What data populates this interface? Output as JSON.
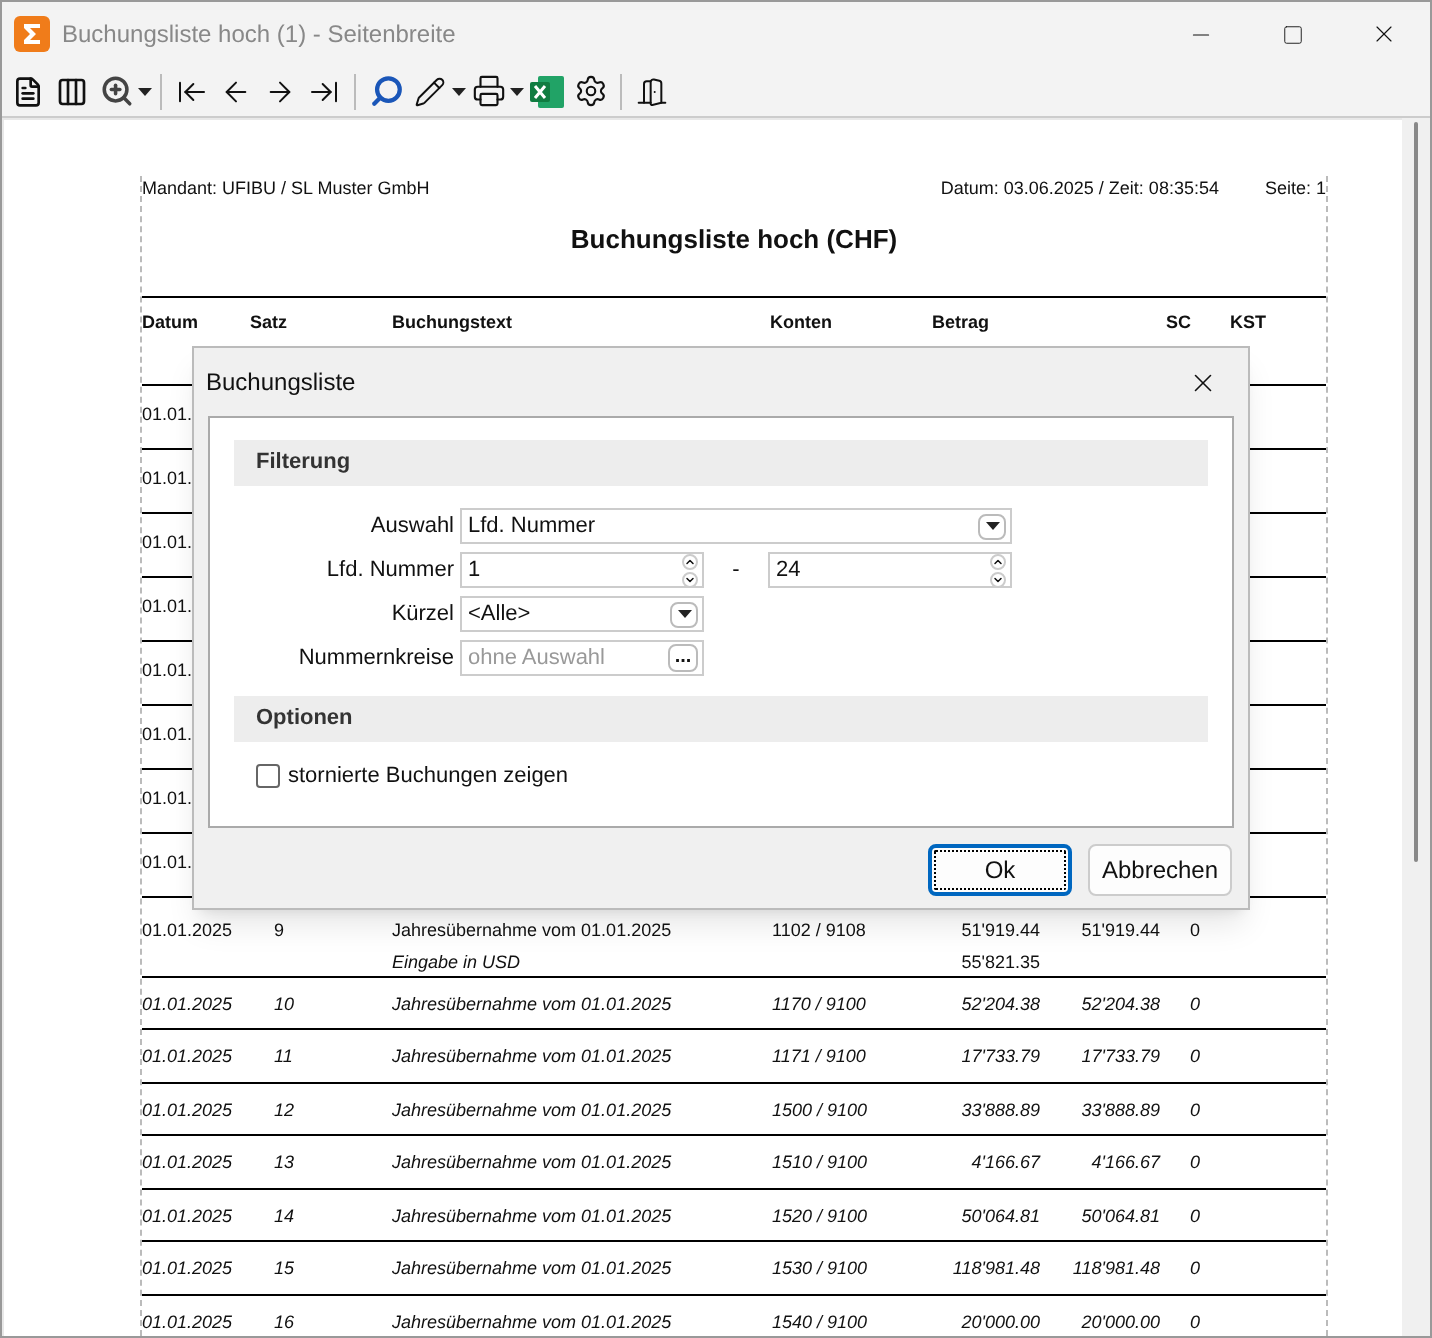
{
  "window": {
    "title": "Buchungsliste hoch (1) - Seitenbreite"
  },
  "report": {
    "mandant": "Mandant: UFIBU / SL Muster GmbH",
    "datetime": "Datum: 03.06.2025 / Zeit: 08:35:54",
    "page": "Seite: 1",
    "title": "Buchungsliste hoch (CHF)",
    "columns": [
      "Datum",
      "Satz",
      "Buchungstext",
      "Konten",
      "Betrag",
      "SC",
      "KST"
    ],
    "hidden_rows": [
      {
        "date": "01.01."
      },
      {
        "date": "01.01."
      },
      {
        "date": "01.01."
      },
      {
        "date": "01.01."
      },
      {
        "date": "01.01."
      },
      {
        "date": "01.01."
      },
      {
        "date": "01.01."
      },
      {
        "date": "01.01."
      }
    ],
    "rows": [
      {
        "kind": "regular",
        "date": "01.01.2025",
        "nr": "9",
        "text": "Jahresübernahme vom 01.01.2025",
        "note": "Eingabe in USD",
        "accounts": "1102 / 9108",
        "amount_1": "51'919.44",
        "amount_1b": "55'821.35",
        "amount_2": "51'919.44",
        "sc": "0"
      },
      {
        "kind": "italic",
        "date": "01.01.2025",
        "nr": "10",
        "text": "Jahresübernahme vom 01.01.2025",
        "accounts": "1170 / 9100",
        "amount_1": "52'204.38",
        "amount_2": "52'204.38",
        "sc": "0"
      },
      {
        "kind": "italic",
        "date": "01.01.2025",
        "nr": "11",
        "text": "Jahresübernahme vom 01.01.2025",
        "accounts": "1171 / 9100",
        "amount_1": "17'733.79",
        "amount_2": "17'733.79",
        "sc": "0"
      },
      {
        "kind": "italic",
        "date": "01.01.2025",
        "nr": "12",
        "text": "Jahresübernahme vom 01.01.2025",
        "accounts": "1500 / 9100",
        "amount_1": "33'888.89",
        "amount_2": "33'888.89",
        "sc": "0"
      },
      {
        "kind": "italic",
        "date": "01.01.2025",
        "nr": "13",
        "text": "Jahresübernahme vom 01.01.2025",
        "accounts": "1510 / 9100",
        "amount_1": "4'166.67",
        "amount_2": "4'166.67",
        "sc": "0"
      },
      {
        "kind": "italic",
        "date": "01.01.2025",
        "nr": "14",
        "text": "Jahresübernahme vom 01.01.2025",
        "accounts": "1520 / 9100",
        "amount_1": "50'064.81",
        "amount_2": "50'064.81",
        "sc": "0"
      },
      {
        "kind": "italic",
        "date": "01.01.2025",
        "nr": "15",
        "text": "Jahresübernahme vom 01.01.2025",
        "accounts": "1530 / 9100",
        "amount_1": "118'981.48",
        "amount_2": "118'981.48",
        "sc": "0"
      },
      {
        "kind": "italic",
        "date": "01.01.2025",
        "nr": "16",
        "text": "Jahresübernahme vom 01.01.2025",
        "accounts": "1540 / 9100",
        "amount_1": "20'000.00",
        "amount_2": "20'000.00",
        "sc": "0"
      }
    ]
  },
  "dialog": {
    "title": "Buchungsliste",
    "filter_section": "Filterung",
    "auswahl": {
      "label": "Auswahl",
      "value": "Lfd. Nummer"
    },
    "lfd": {
      "label": "Lfd. Nummer",
      "from": "1",
      "separator": "-",
      "to": "24"
    },
    "kuerzel": {
      "label": "Kürzel",
      "value": "<Alle>"
    },
    "nummernkreise": {
      "label": "Nummernkreise",
      "placeholder": "ohne Auswahl",
      "button": "..."
    },
    "options_section": "Optionen",
    "options": [
      {
        "label": "stornierte Buchungen zeigen",
        "checked": false
      }
    ],
    "buttons": [
      {
        "label": "Ok",
        "default": true
      },
      {
        "label": "Abbrechen",
        "default": false
      }
    ]
  }
}
